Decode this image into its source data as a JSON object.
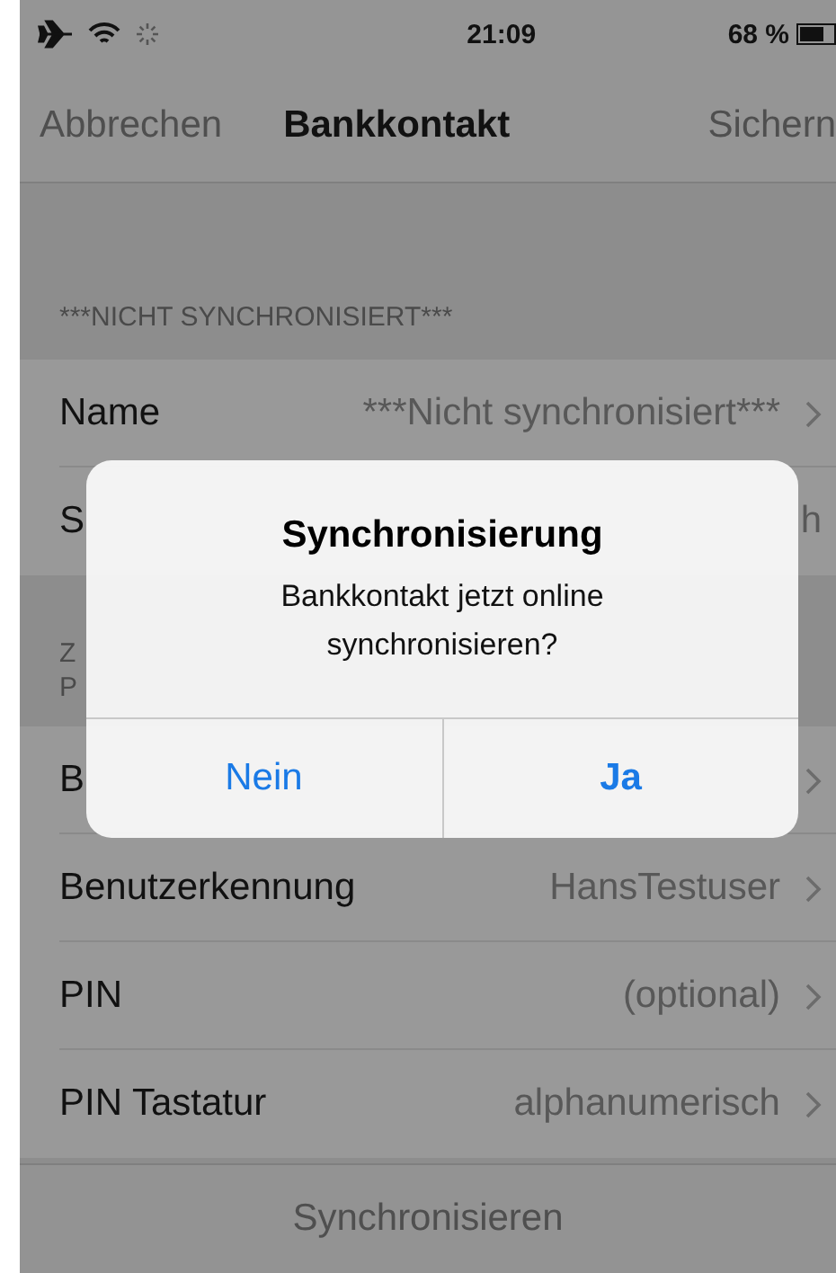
{
  "status_bar": {
    "time": "21:09",
    "battery": "68 %"
  },
  "nav": {
    "cancel": "Abbrechen",
    "title": "Bankkontakt",
    "save": "Sichern"
  },
  "sections": [
    {
      "header_lines": [
        "***NICHT SYNCHRONISIERT***"
      ],
      "rows": [
        {
          "label": "Name",
          "value": "***Nicht synchronisiert***",
          "chevron": true
        },
        {
          "label": "S",
          "value": "h",
          "chevron": false
        }
      ]
    },
    {
      "header_lines": [
        "Z",
        "P"
      ],
      "rows": [
        {
          "label": "B",
          "chevron": true
        },
        {
          "label": "Benutzerkennung",
          "value": "HansTestuser",
          "chevron": true
        },
        {
          "label": "PIN",
          "value": "(optional)",
          "chevron": true
        },
        {
          "label": "PIN Tastatur",
          "value": "alphanumerisch",
          "chevron": true
        }
      ]
    }
  ],
  "toolbar": {
    "button": "Synchronisieren"
  },
  "alert": {
    "title": "Synchronisierung",
    "message": "Bankkontakt jetzt online synchronisieren?",
    "buttons": [
      {
        "label": "Nein",
        "bold": false
      },
      {
        "label": "Ja",
        "bold": true
      }
    ]
  }
}
